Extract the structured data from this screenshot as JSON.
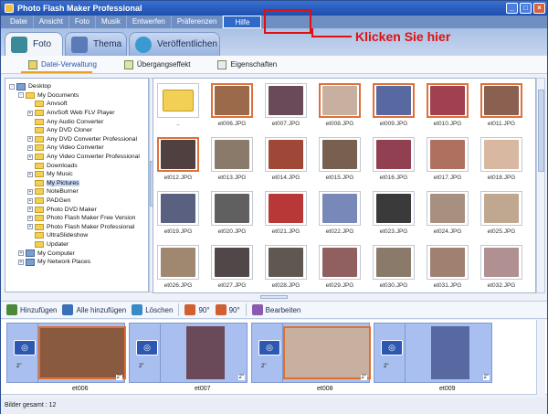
{
  "app": {
    "title": "Photo Flash Maker Professional"
  },
  "menu": [
    {
      "label": "Datei"
    },
    {
      "label": "Ansicht"
    },
    {
      "label": "Foto"
    },
    {
      "label": "Musik"
    },
    {
      "label": "Entwerfen"
    },
    {
      "label": "Präferenzen"
    },
    {
      "label": "Hilfe"
    }
  ],
  "annotation": {
    "text": "Klicken Sie hier"
  },
  "tabs": [
    {
      "label": "Foto"
    },
    {
      "label": "Thema"
    },
    {
      "label": "Veröffentlichen"
    }
  ],
  "subtabs": [
    {
      "label": "Datei-Verwaltung"
    },
    {
      "label": "Übergangseffekt"
    },
    {
      "label": "Eigenschaften"
    }
  ],
  "tree": [
    {
      "label": "Desktop",
      "exp": "-",
      "icon": "desktop"
    },
    {
      "label": "My Documents",
      "exp": "-",
      "icon": "folder"
    },
    {
      "label": "Anvsoft",
      "exp": "",
      "icon": "folder"
    },
    {
      "label": "AnvSoft Web FLV Player",
      "exp": "+",
      "icon": "folder"
    },
    {
      "label": "Any Audio Converter",
      "exp": "",
      "icon": "folder"
    },
    {
      "label": "Any DVD Cloner",
      "exp": "",
      "icon": "folder"
    },
    {
      "label": "Any DVD Converter Professional",
      "exp": "+",
      "icon": "folder"
    },
    {
      "label": "Any Video Converter",
      "exp": "+",
      "icon": "folder"
    },
    {
      "label": "Any Video Converter Professional",
      "exp": "+",
      "icon": "folder"
    },
    {
      "label": "Downloads",
      "exp": "",
      "icon": "folder"
    },
    {
      "label": "My Music",
      "exp": "+",
      "icon": "folder"
    },
    {
      "label": "My Pictures",
      "exp": "",
      "icon": "folder"
    },
    {
      "label": "NoteBurner",
      "exp": "+",
      "icon": "folder"
    },
    {
      "label": "PADGen",
      "exp": "+",
      "icon": "folder"
    },
    {
      "label": "Photo DVD Maker",
      "exp": "+",
      "icon": "folder"
    },
    {
      "label": "Photo Flash Maker Free Version",
      "exp": "+",
      "icon": "folder"
    },
    {
      "label": "Photo Flash Maker Professional",
      "exp": "+",
      "icon": "folder"
    },
    {
      "label": "UltraSlideshow",
      "exp": "",
      "icon": "folder"
    },
    {
      "label": "Updater",
      "exp": "",
      "icon": "folder"
    },
    {
      "label": "My Computer",
      "exp": "+",
      "icon": "computer"
    },
    {
      "label": "My Network Places",
      "exp": "+",
      "icon": "computer"
    }
  ],
  "files": [
    {
      "name": "..",
      "folder": true
    },
    {
      "name": "et006.JPG",
      "sel": true,
      "c": "#9a6a4a"
    },
    {
      "name": "et007.JPG",
      "c": "#6a4a58"
    },
    {
      "name": "et008.JPG",
      "sel": true,
      "c": "#c8b0a0"
    },
    {
      "name": "et009.JPG",
      "sel": true,
      "c": "#5868a0"
    },
    {
      "name": "et010.JPG",
      "sel": true,
      "c": "#a04050"
    },
    {
      "name": "et011.JPG",
      "sel": true,
      "c": "#8a6050"
    },
    {
      "name": "et012.JPG",
      "sel": true,
      "c": "#504040"
    },
    {
      "name": "et013.JPG",
      "c": "#8a7a6a"
    },
    {
      "name": "et014.JPG",
      "c": "#a04838"
    },
    {
      "name": "et015.JPG",
      "c": "#786050"
    },
    {
      "name": "et016.JPG",
      "c": "#904050"
    },
    {
      "name": "et017.JPG",
      "c": "#b07060"
    },
    {
      "name": "et018.JPG",
      "c": "#d8b8a0"
    },
    {
      "name": "et019.JPG",
      "c": "#5a6080"
    },
    {
      "name": "et020.JPG",
      "c": "#606060"
    },
    {
      "name": "et021.JPG",
      "c": "#b83838"
    },
    {
      "name": "et022.JPG",
      "c": "#7888b8"
    },
    {
      "name": "et023.JPG",
      "c": "#3a3a3a"
    },
    {
      "name": "et024.JPG",
      "c": "#a89080"
    },
    {
      "name": "et025.JPG",
      "c": "#c0a890"
    },
    {
      "name": "et026.JPG",
      "c": "#a08870"
    },
    {
      "name": "et027.JPG",
      "c": "#504848"
    },
    {
      "name": "et028.JPG",
      "c": "#605850"
    },
    {
      "name": "et029.JPG",
      "c": "#906060"
    },
    {
      "name": "et030.JPG",
      "c": "#8a7a6a"
    },
    {
      "name": "et031.JPG",
      "c": "#a08070"
    },
    {
      "name": "et032.JPG",
      "c": "#b09090"
    }
  ],
  "toolbar": [
    {
      "label": "Hinzufügen",
      "c": "#4a8a3a"
    },
    {
      "label": "Alle hinzufügen",
      "c": "#3a70b8"
    },
    {
      "label": "Löschen",
      "c": "#3a8ac8"
    },
    {
      "label": "90°",
      "c": "#d06030"
    },
    {
      "label": "90°",
      "c": "#d06030"
    },
    {
      "label": "Bearbeiten",
      "c": "#8a5ab0"
    }
  ],
  "timeline": [
    {
      "type": "trans",
      "dur": "2\""
    },
    {
      "type": "frame",
      "name": "et006",
      "dur": "2\"",
      "c": "#8a5a40",
      "wide": true
    },
    {
      "type": "trans",
      "dur": "2\""
    },
    {
      "type": "frame",
      "name": "et007",
      "dur": "2\"",
      "c": "#6a4a58"
    },
    {
      "type": "trans",
      "dur": "2\""
    },
    {
      "type": "frame",
      "name": "et008",
      "dur": "2\"",
      "c": "#c8b0a0",
      "wide": true
    },
    {
      "type": "trans",
      "dur": "2\""
    },
    {
      "type": "frame",
      "name": "et009",
      "dur": "2\"",
      "c": "#5868a0"
    }
  ],
  "status": {
    "text": "Bilder gesamt : 12"
  }
}
